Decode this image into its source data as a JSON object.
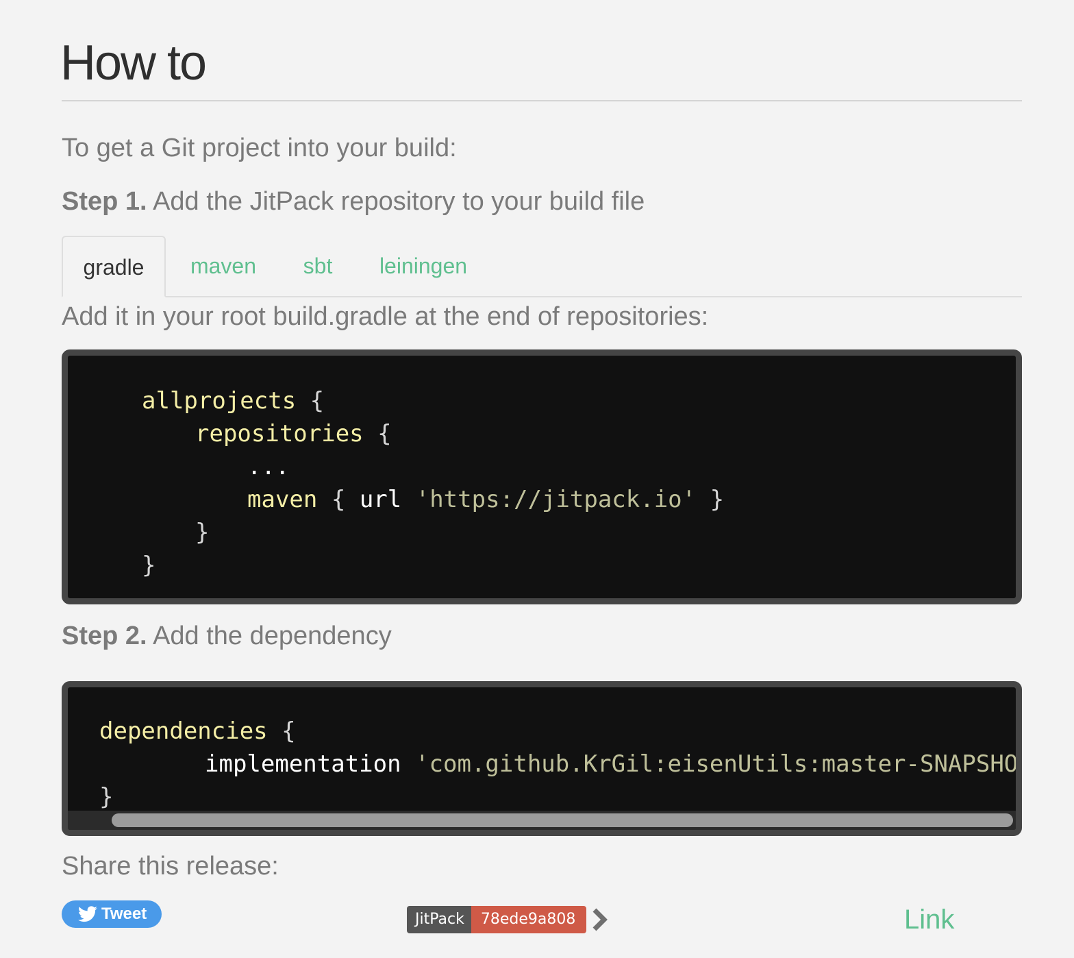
{
  "page": {
    "title": "How to",
    "intro": "To get a Git project into your build:"
  },
  "step1": {
    "label": "Step 1.",
    "text": " Add the JitPack repository to your build file"
  },
  "tabs": [
    {
      "label": "gradle",
      "active": true
    },
    {
      "label": "maven",
      "active": false
    },
    {
      "label": "sbt",
      "active": false
    },
    {
      "label": "leiningen",
      "active": false
    }
  ],
  "instruction": "Add it in your root build.gradle at the end of repositories:",
  "code1": {
    "allprojects": "allprojects",
    "repositories": "repositories",
    "ellipsis": "...",
    "maven": "maven",
    "url": "url",
    "url_value": "'https://jitpack.io'",
    "open_brace": "{",
    "close_brace": "}"
  },
  "step2": {
    "label": "Step 2.",
    "text": " Add the dependency"
  },
  "code2": {
    "dependencies": "dependencies",
    "implementation": "implementation",
    "artifact": "'com.github.KrGil:eisenUtils:master-SNAPSHOT'",
    "open_brace": "{",
    "close_brace": "}"
  },
  "share": {
    "label": "Share this release:",
    "tweet": "Tweet",
    "badge_left": "JitPack",
    "badge_right": "78ede9a808",
    "link": "Link"
  },
  "colors": {
    "accent": "#5fbf8f",
    "keyword": "#f4eea6",
    "string": "#bfc09a",
    "tweet": "#4a9ae9",
    "badge_version": "#cf5a47"
  },
  "icons": {
    "tweet": "twitter-bird-icon",
    "badge": "chevron-right-icon"
  }
}
